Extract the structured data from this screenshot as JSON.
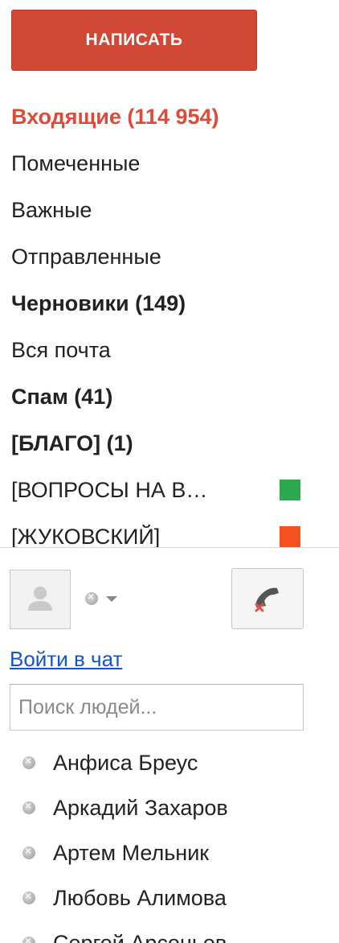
{
  "compose_label": "НАПИСАТЬ",
  "nav": [
    {
      "label": "Входящие (114 954)",
      "style": "active"
    },
    {
      "label": "Помеченные",
      "style": "normal"
    },
    {
      "label": "Важные",
      "style": "normal"
    },
    {
      "label": "Отправленные",
      "style": "normal"
    },
    {
      "label": "Черновики (149)",
      "style": "bold"
    },
    {
      "label": "Вся почта",
      "style": "normal"
    },
    {
      "label": "Спам (41)",
      "style": "bold"
    },
    {
      "label": "[БЛАГО] (1)",
      "style": "bold"
    },
    {
      "label": "[ВОПРОСЫ НА В…",
      "style": "normal",
      "label_color": "#2ca94f"
    },
    {
      "label": "[ЖУКОВСКИЙ]",
      "style": "normal",
      "label_color": "#f4511e"
    }
  ],
  "chat": {
    "signin_link": "Войти в чат",
    "search_placeholder": "Поиск людей...",
    "status_icon": "offline-dot-icon",
    "avatar_icon": "person-placeholder-icon",
    "phone_icon": "phone-disabled-icon"
  },
  "contacts": [
    "Анфиса Бреус",
    "Аркадий Захаров",
    "Артем Мельник",
    "Любовь Алимова",
    "Сергей Арсеньев"
  ],
  "colors": {
    "accent": "#d14836",
    "active_text": "#dd4b39",
    "link": "#1155cc"
  }
}
